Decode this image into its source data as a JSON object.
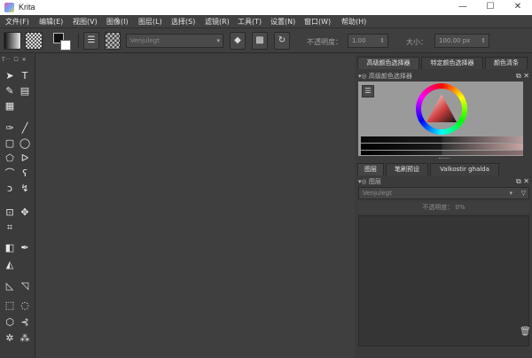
{
  "window": {
    "title": "Krita",
    "minimize": "—",
    "maximize": "☐",
    "close": "✕"
  },
  "menu": [
    "文件(F)",
    "编辑(E)",
    "视图(V)",
    "图像(I)",
    "图层(L)",
    "选择(S)",
    "滤镜(R)",
    "工具(T)",
    "设置(N)",
    "窗口(W)",
    "帮助(H)"
  ],
  "toolbar": {
    "brush_preset": "Venjulegt",
    "opacity_label": "不透明度：",
    "opacity_value": "1.00",
    "size_label": "大小：",
    "size_value": "100.00 px"
  },
  "toolbox": {
    "header": "T·· ☐ ✕"
  },
  "dock": {
    "top_tabs": [
      "高级颜色选择器",
      "特定颜色选择器",
      "颜色清条"
    ],
    "selector_title": "高级颜色选择器",
    "bottom_tabs": [
      "图层",
      "笔刷预设",
      "Valkostir ghalda"
    ],
    "layers_title": "图层",
    "layers_preset": "Venjulegt",
    "opacity_text": "不透明度： 0%"
  },
  "colors": {
    "accent": "#e05a2b"
  }
}
